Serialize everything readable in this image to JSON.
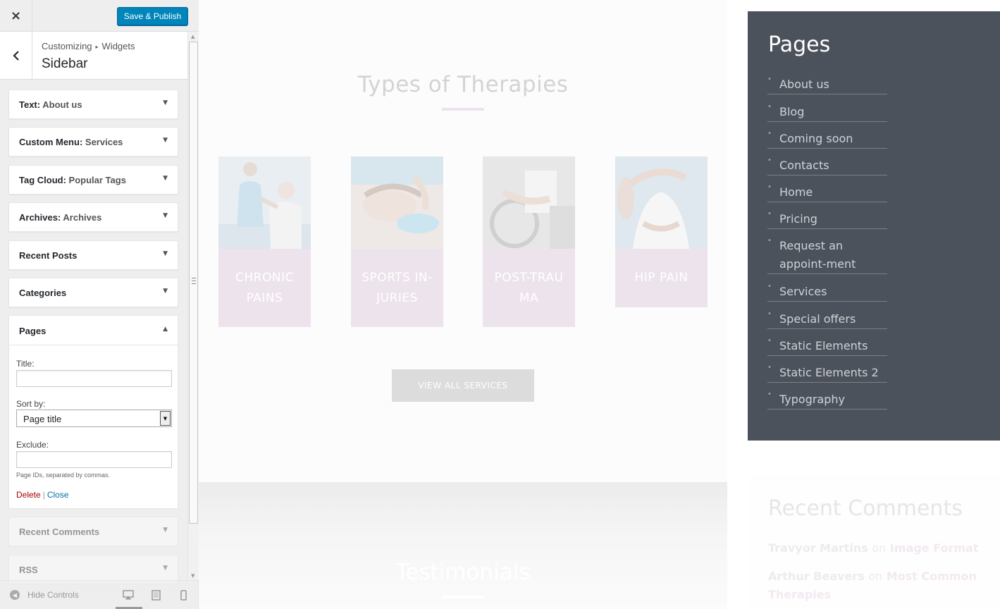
{
  "topbar": {
    "close_icon": "×",
    "publish_label": "Save & Publish"
  },
  "section": {
    "breadcrumb_root": "Customizing",
    "breadcrumb_sep": "▸",
    "breadcrumb_current": "Widgets",
    "title": "Sidebar"
  },
  "widgets": [
    {
      "type": "Text:",
      "name": "About us"
    },
    {
      "type": "Custom Menu:",
      "name": "Services"
    },
    {
      "type": "Tag Cloud:",
      "name": "Popular Tags"
    },
    {
      "type": "Archives:",
      "name": "Archives"
    },
    {
      "type": "Recent Posts",
      "name": ""
    },
    {
      "type": "Categories",
      "name": ""
    }
  ],
  "pages_widget": {
    "title": "Pages",
    "title_label": "Title:",
    "title_value": "",
    "sort_label": "Sort by:",
    "sort_value": "Page title",
    "exclude_label": "Exclude:",
    "exclude_value": "",
    "exclude_hint": "Page IDs, separated by commas.",
    "delete_label": "Delete",
    "separator": "|",
    "close_label": "Close"
  },
  "widgets_after": [
    {
      "type": "Recent Comments"
    },
    {
      "type": "RSS"
    }
  ],
  "footer": {
    "hide_label": "Hide Controls"
  },
  "preview": {
    "therapies_title": "Types of Therapies",
    "cards": [
      {
        "label": "CHRONIC PAINS"
      },
      {
        "label": "SPORTS IN-JURIES"
      },
      {
        "label": "POST-TRAU MA"
      },
      {
        "label": "HIP PAIN"
      }
    ],
    "view_all": "VIEW ALL SERVICES",
    "testimonials_title": "Testimonials",
    "sidebar_title": "Pages",
    "sidebar_pages": [
      "About us",
      "Blog",
      "Coming soon",
      "Contacts",
      "Home",
      "Pricing",
      "Request an appoint-ment",
      "Services",
      "Special offers",
      "Static Elements",
      "Static Elements 2",
      "Typography"
    ],
    "recent_comments_title": "Recent Comments",
    "comments": [
      {
        "author": "Travyor Martins",
        "on": "on",
        "post": "Image Format"
      },
      {
        "author": "Arthur Beavers",
        "on": "on",
        "post": "Most Common Therapies"
      }
    ]
  },
  "colors": {
    "publish_button": "#0085ba",
    "sidebar_background": "#4c525c",
    "card_label_background": "#ede3ec",
    "delete_link": "#a00",
    "close_link": "#0073aa"
  },
  "icons": {
    "close": "close-icon",
    "back": "chevron-left-icon",
    "collapse": "arrow-down-icon",
    "expand": "arrow-up-icon",
    "select": "dropdown-arrow-icon",
    "hide": "hide-controls-icon",
    "desktop": "desktop-icon",
    "tablet": "tablet-icon",
    "mobile": "mobile-icon"
  }
}
